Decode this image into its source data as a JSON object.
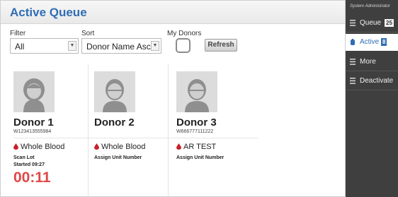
{
  "header": {
    "title": "Active Queue"
  },
  "filters": {
    "filter_label": "Filter",
    "filter_value": "All",
    "sort_label": "Sort",
    "sort_value": "Donor Name Asc",
    "my_donors_label": "My Donors",
    "refresh_label": "Refresh"
  },
  "donors": [
    {
      "name": "Donor 1",
      "id": "W123413555984",
      "product": "Whole Blood",
      "action": "Scan Lot",
      "started": "Started 09:27",
      "timer": "00:11",
      "avatar": "female"
    },
    {
      "name": "Donor 2",
      "id": "",
      "product": "Whole Blood",
      "action": "Assign Unit Number",
      "avatar": "male"
    },
    {
      "name": "Donor 3",
      "id": "W666777111222",
      "product": "AR TEST",
      "action": "Assign Unit Number",
      "avatar": "male"
    }
  ],
  "sidebar": {
    "role": "System Administrator",
    "items": [
      {
        "label": "Queue",
        "count": "25",
        "icon": "menu-icon",
        "active": false
      },
      {
        "label": "Active",
        "count": "8",
        "icon": "blood-bag-icon",
        "active": true
      },
      {
        "label": "More",
        "icon": "menu-icon",
        "active": false
      },
      {
        "label": "Deactivate",
        "icon": "menu-icon",
        "active": false
      }
    ]
  },
  "colors": {
    "accent": "#2f6db5",
    "timer": "#e04848",
    "blood": "#c8202b",
    "sidebar": "#3f3f3f"
  }
}
